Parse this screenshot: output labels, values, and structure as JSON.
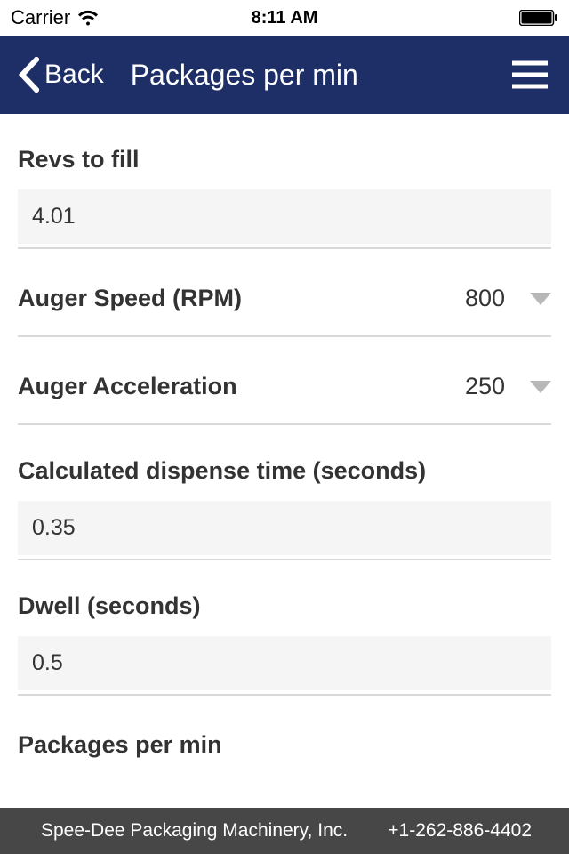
{
  "status": {
    "carrier": "Carrier",
    "time": "8:11 AM"
  },
  "nav": {
    "back_label": "Back",
    "title": "Packages per min"
  },
  "fields": {
    "revs": {
      "label": "Revs to fill",
      "value": "4.01"
    },
    "speed": {
      "label": "Auger Speed (RPM)",
      "value": "800"
    },
    "accel": {
      "label": "Auger Acceleration",
      "value": "250"
    },
    "dispense": {
      "label": "Calculated dispense time (seconds)",
      "value": "0.35"
    },
    "dwell": {
      "label": "Dwell (seconds)",
      "value": "0.5"
    },
    "ppm": {
      "label": "Packages per min"
    }
  },
  "footer": {
    "company": "Spee-Dee Packaging Machinery, Inc.",
    "phone": "+1-262-886-4402"
  }
}
